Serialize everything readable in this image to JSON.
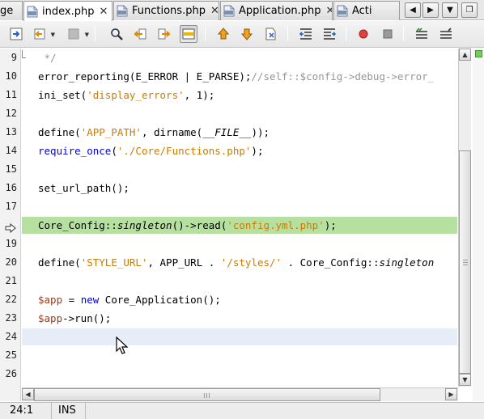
{
  "tabs": [
    {
      "label": "ge",
      "active": false,
      "has_icon": false,
      "has_close": false
    },
    {
      "label": "index.php",
      "active": true,
      "has_icon": true,
      "has_close": true
    },
    {
      "label": "Functions.php",
      "active": false,
      "has_icon": true,
      "has_close": true
    },
    {
      "label": "Application.php",
      "active": false,
      "has_icon": true,
      "has_close": true
    },
    {
      "label": "Acti",
      "active": false,
      "has_icon": true,
      "has_close": false
    }
  ],
  "tab_glyphs": {
    "prefix": "...",
    "close": "✕",
    "nav_left": "◀",
    "nav_right": "▶",
    "nav_down": "▼",
    "nav_restore": "❐"
  },
  "toolbar_icons": [
    "last-edit-icon",
    "back-icon",
    "forward-icon",
    "find-icon",
    "find-previous-icon",
    "find-next-icon",
    "toggle-highlight-icon",
    "previous-bookmark-icon",
    "next-bookmark-icon",
    "toggle-bookmark-icon",
    "shift-left-icon",
    "shift-right-icon",
    "start-macro-icon",
    "stop-macro-icon",
    "comment-icon",
    "uncomment-icon"
  ],
  "editor": {
    "line_numbers": [
      "9",
      "10",
      "11",
      "12",
      "13",
      "14",
      "15",
      "16",
      "17",
      "18",
      "19",
      "20",
      "21",
      "22",
      "23",
      "24",
      "25",
      "26"
    ],
    "debug_line_index": 9,
    "current_line_index": 15,
    "lines": [
      [
        {
          "t": " */",
          "c": "c"
        }
      ],
      [
        {
          "t": "error_reporting(E_ERROR | E_PARSE);",
          "c": ""
        },
        {
          "t": "//self::$config->debug->error_",
          "c": "c"
        }
      ],
      [
        {
          "t": "ini_set(",
          "c": ""
        },
        {
          "t": "'display_errors'",
          "c": "s"
        },
        {
          "t": ", 1);",
          "c": ""
        }
      ],
      [],
      [
        {
          "t": "define(",
          "c": ""
        },
        {
          "t": "'APP_PATH'",
          "c": "s"
        },
        {
          "t": ", dirname(",
          "c": ""
        },
        {
          "t": "__FILE__",
          "c": "i"
        },
        {
          "t": "));",
          "c": ""
        }
      ],
      [
        {
          "t": "require_once",
          "c": "k"
        },
        {
          "t": "(",
          "c": ""
        },
        {
          "t": "'./Core/Functions.php'",
          "c": "s"
        },
        {
          "t": ");",
          "c": ""
        }
      ],
      [],
      [
        {
          "t": "set_url_path();",
          "c": ""
        }
      ],
      [],
      [
        {
          "t": "Core_Config::",
          "c": ""
        },
        {
          "t": "singleton",
          "c": "i"
        },
        {
          "t": "()->read(",
          "c": ""
        },
        {
          "t": "'config.yml.php'",
          "c": "s"
        },
        {
          "t": ");",
          "c": ""
        }
      ],
      [],
      [
        {
          "t": "define(",
          "c": ""
        },
        {
          "t": "'STYLE_URL'",
          "c": "s"
        },
        {
          "t": ", APP_URL . ",
          "c": ""
        },
        {
          "t": "'/styles/'",
          "c": "s"
        },
        {
          "t": " . Core_Config::",
          "c": ""
        },
        {
          "t": "singleton",
          "c": "i"
        }
      ],
      [],
      [
        {
          "t": "$app",
          "c": "v"
        },
        {
          "t": " = ",
          "c": ""
        },
        {
          "t": "new",
          "c": "k"
        },
        {
          "t": " Core_Application();",
          "c": ""
        }
      ],
      [
        {
          "t": "$app",
          "c": "v"
        },
        {
          "t": "->run();",
          "c": ""
        }
      ],
      [],
      [],
      []
    ]
  },
  "status": {
    "position": "24:1",
    "mode": "INS"
  },
  "colors": {
    "debug_line": "#b6e0a0",
    "current_line": "#e6edf6",
    "keyword": "#0000e6",
    "string": "#ce7b00",
    "comment": "#969696",
    "variable": "#a03a1a"
  }
}
